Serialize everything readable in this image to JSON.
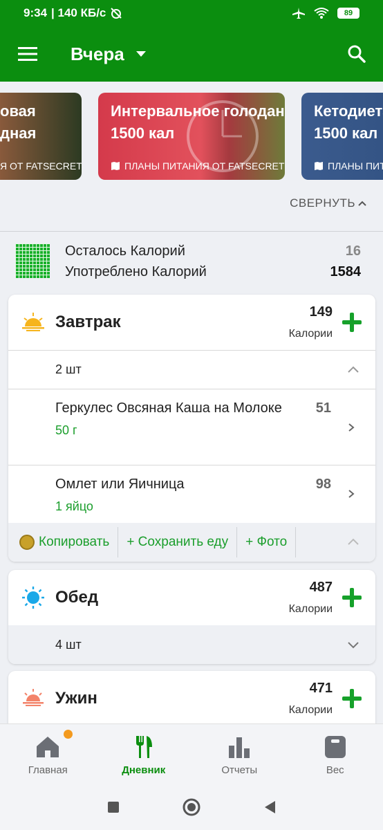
{
  "status_bar": {
    "time": "9:34",
    "network_speed": "| 140 КБ/с",
    "battery": "89"
  },
  "app_bar": {
    "title": "Вчера"
  },
  "plans": [
    {
      "line1": "овая",
      "line2": "дная",
      "source": "Я ОТ FATSECRET"
    },
    {
      "line1": "Интервальное голодани",
      "line2": "1500 кал",
      "source": "ПЛАНЫ ПИТАНИЯ ОТ FATSECRET"
    },
    {
      "line1": "Кетодиета",
      "line2": "1500 кал",
      "source": "ПЛАНЫ ПИТ"
    }
  ],
  "collapse_label": "СВЕРНУТЬ",
  "summary": {
    "remaining_label": "Осталось Калорий",
    "remaining_value": "16",
    "consumed_label": "Употреблено Калорий",
    "consumed_value": "1584"
  },
  "meals": {
    "breakfast": {
      "name": "Завтрак",
      "calories": "149",
      "calories_label": "Калории",
      "count": "2 шт",
      "items": [
        {
          "name": "Геркулес Овсяная Каша на Молоке",
          "portion": "50 г",
          "calories": "51"
        },
        {
          "name": "Омлет или Яичница",
          "portion": "1 яйцо",
          "calories": "98"
        }
      ],
      "actions": {
        "copy": "Копировать",
        "save": "+ Сохранить еду",
        "photo": "+ Фото"
      }
    },
    "lunch": {
      "name": "Обед",
      "calories": "487",
      "calories_label": "Калории",
      "count": "4 шт"
    },
    "dinner": {
      "name": "Ужин",
      "calories": "471",
      "calories_label": "Калории"
    }
  },
  "bottom_nav": [
    {
      "label": "Главная",
      "icon": "home-icon"
    },
    {
      "label": "Дневник",
      "icon": "fork-knife-icon"
    },
    {
      "label": "Отчеты",
      "icon": "bar-chart-icon"
    },
    {
      "label": "Вес",
      "icon": "scale-icon"
    }
  ],
  "colors": {
    "primary": "#0b8e0f",
    "accent_green": "#16a12a",
    "badge": "#f39a1f"
  }
}
